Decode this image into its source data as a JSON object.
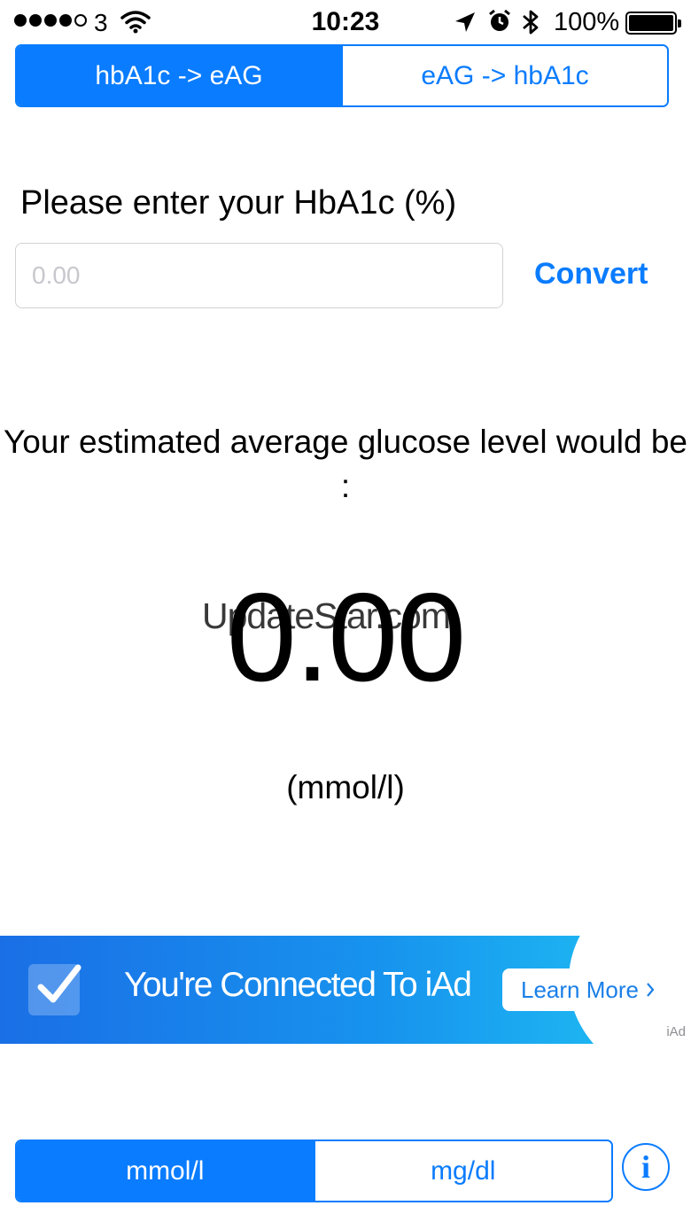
{
  "status_bar": {
    "carrier": "3",
    "time": "10:23",
    "battery_percent": "100%",
    "signal_bars_filled": 4,
    "signal_bars_total": 5
  },
  "mode_segmented": {
    "options": [
      "hbA1c -> eAG",
      "eAG -> hbA1c"
    ],
    "selected_index": 0
  },
  "form": {
    "prompt": "Please enter your HbA1c (%)",
    "input_placeholder": "0.00",
    "input_value": "",
    "convert_label": "Convert"
  },
  "result": {
    "label": "Your estimated average glucose level would be :",
    "value": "0.00",
    "unit": "(mmol/l)"
  },
  "watermark": "UpdateStar.com",
  "ad_banner": {
    "text": "You're Connected To iAd",
    "button_label": "Learn More",
    "tag": "iAd",
    "colors": {
      "start": "#1a6fe6",
      "end": "#20c3f3"
    }
  },
  "unit_segmented": {
    "options": [
      "mmol/l",
      "mg/dl"
    ],
    "selected_index": 0
  },
  "info_button": {
    "label": "i"
  },
  "colors": {
    "accent": "#0a7cff"
  }
}
